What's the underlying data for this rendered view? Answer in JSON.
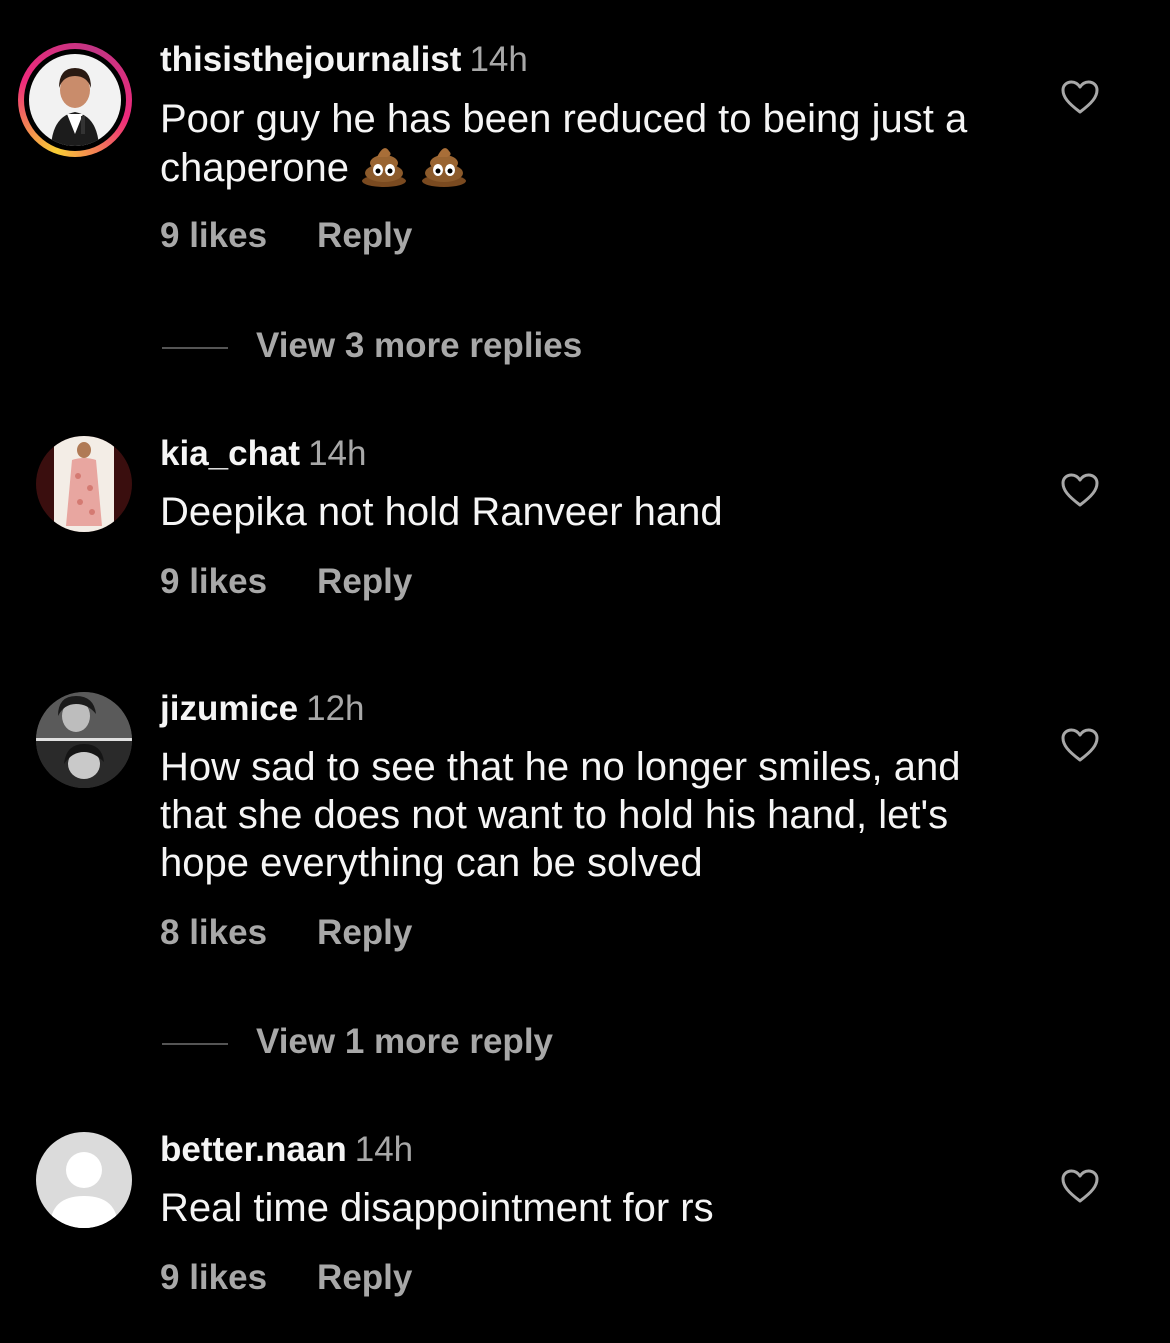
{
  "colors": {
    "background": "#000000",
    "text_primary": "#f5f5f5",
    "text_secondary": "#a8a8a8",
    "story_ring": [
      "#f9ce34",
      "#ee2a7b",
      "#c13584"
    ]
  },
  "comments": [
    {
      "username": "thisisthejournalist",
      "time": "14h",
      "text": "Poor guy he has been reduced to being just a chaperone",
      "emojis": [
        "poop-emoji",
        "poop-emoji"
      ],
      "likes": "9 likes",
      "reply": "Reply",
      "view_more": "View 3 more replies",
      "avatar_icon": "avatar-photo",
      "has_story_ring": true
    },
    {
      "username": "kia_chat",
      "time": "14h",
      "text": "Deepika not hold Ranveer hand",
      "likes": "9 likes",
      "reply": "Reply",
      "avatar_icon": "avatar-photo"
    },
    {
      "username": "jizumice",
      "time": "12h",
      "text": "How sad to see that he no longer smiles, and that she does not want to hold his hand, let's hope everything can be solved",
      "likes": "8 likes",
      "reply": "Reply",
      "view_more": "View 1 more reply",
      "avatar_icon": "avatar-photo"
    },
    {
      "username": "better.naan",
      "time": "14h",
      "text": "Real time disappointment for rs",
      "likes": "9 likes",
      "reply": "Reply",
      "avatar_icon": "default-avatar-icon"
    }
  ],
  "icons": {
    "like": "heart-outline-icon"
  }
}
